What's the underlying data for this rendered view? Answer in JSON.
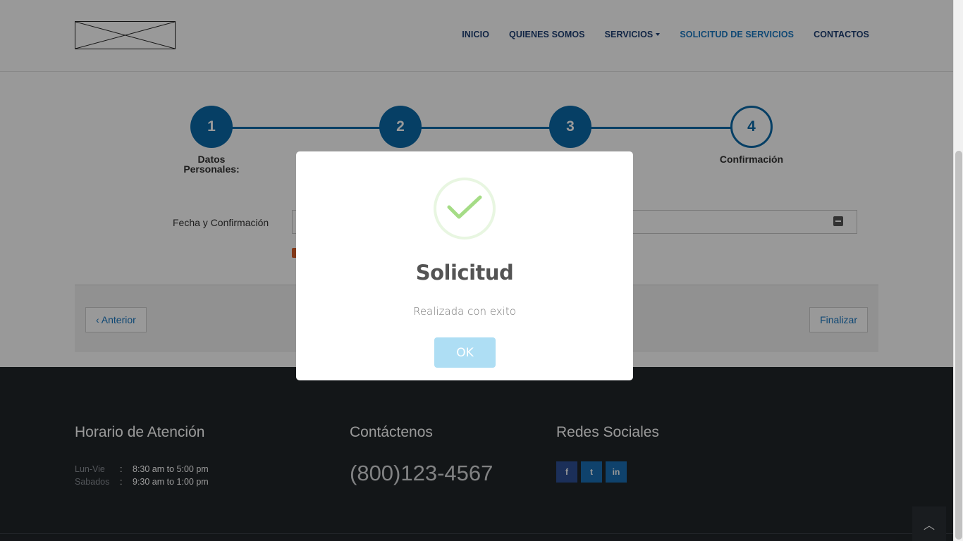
{
  "header": {
    "nav": [
      {
        "label": "INICIO"
      },
      {
        "label": "QUIENES SOMOS"
      },
      {
        "label": "SERVICIOS"
      },
      {
        "label": "SOLICITUD DE SERVICIOS"
      },
      {
        "label": "CONTACTOS"
      }
    ]
  },
  "wizard": {
    "steps": [
      {
        "number": "1",
        "label_line1": "Datos",
        "label_line2": "Personales:"
      },
      {
        "number": "2"
      },
      {
        "number": "3"
      },
      {
        "number": "4",
        "label_line1": "Confirmación"
      }
    ],
    "form_label": "Fecha y Confirmación",
    "prev_label": "‹ Anterior",
    "finish_label": "Finalizar"
  },
  "footer": {
    "hours_title": "Horario de Atención",
    "hours": [
      {
        "day": "Lun-Vie",
        "sep": ":",
        "time": "8:30 am to 5:00 pm"
      },
      {
        "day": "Sabados",
        "sep": ":",
        "time": "9:30 am to 1:00 pm"
      }
    ],
    "contact_title": "Contáctenos",
    "phone": "(800)123-4567",
    "social_title": "Redes Sociales",
    "social": [
      {
        "icon": "facebook-icon",
        "glyph": "f"
      },
      {
        "icon": "twitter-icon",
        "glyph": "t"
      },
      {
        "icon": "linkedin-icon",
        "glyph": "in"
      }
    ],
    "to_top_glyph": "︿"
  },
  "modal": {
    "title": "Solicitud",
    "text": "Realizada con exito",
    "ok_label": "OK"
  },
  "colors": {
    "primary": "#0b6aa8",
    "nav_text": "#1d3f73",
    "nav_active": "#1a78c2",
    "footer_bg": "#212529",
    "success_green": "#a5dc86",
    "ok_button": "#aedef4"
  }
}
